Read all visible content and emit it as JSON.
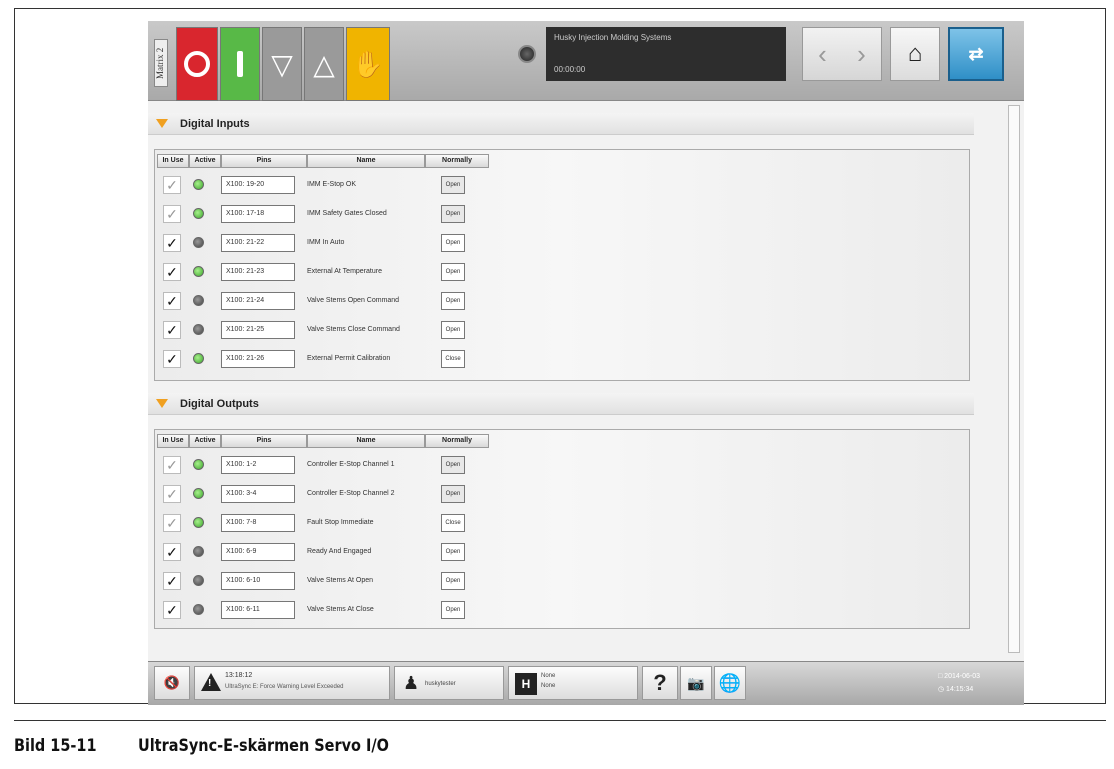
{
  "topbar": {
    "matrix_tab": "Matrix 2",
    "status_title": "Husky Injection Molding Systems",
    "status_time": "00:00:00"
  },
  "inputs": {
    "title": "Digital Inputs",
    "headers": [
      "In Use",
      "Active",
      "Pins",
      "Name",
      "Normally"
    ],
    "rows": [
      {
        "in_use": "✓",
        "active": "green",
        "pin": "X100: 19-20",
        "name": "IMM E-Stop OK",
        "normally": "Open"
      },
      {
        "in_use": "✓",
        "active": "green",
        "pin": "X100: 17-18",
        "name": "IMM Safety Gates Closed",
        "normally": "Open"
      },
      {
        "in_use": "✓",
        "active": "gray",
        "pin": "X100: 21-22",
        "name": "IMM In Auto",
        "normally": "Open"
      },
      {
        "in_use": "✓",
        "active": "green",
        "pin": "X100: 21-23",
        "name": "External At Temperature",
        "normally": "Open"
      },
      {
        "in_use": "✓",
        "active": "gray",
        "pin": "X100: 21-24",
        "name": "Valve Stems Open Command",
        "normally": "Open"
      },
      {
        "in_use": "✓",
        "active": "gray",
        "pin": "X100: 21-25",
        "name": "Valve Stems Close Command",
        "normally": "Open"
      },
      {
        "in_use": "✓",
        "active": "green",
        "pin": "X100: 21-26",
        "name": "External Permit Calibration",
        "normally": "Close"
      }
    ]
  },
  "outputs": {
    "title": "Digital Outputs",
    "headers": [
      "In Use",
      "Active",
      "Pins",
      "Name",
      "Normally"
    ],
    "rows": [
      {
        "in_use": "✓",
        "active": "green",
        "pin": "X100: 1-2",
        "name": "Controller E-Stop Channel 1",
        "normally": "Open"
      },
      {
        "in_use": "✓",
        "active": "green",
        "pin": "X100: 3-4",
        "name": "Controller E-Stop Channel 2",
        "normally": "Open"
      },
      {
        "in_use": "✓",
        "active": "green",
        "pin": "X100: 7-8",
        "name": "Fault Stop Immediate",
        "normally": "Close"
      },
      {
        "in_use": "✓",
        "active": "gray",
        "pin": "X100: 6-9",
        "name": "Ready And Engaged",
        "normally": "Open"
      },
      {
        "in_use": "✓",
        "active": "gray",
        "pin": "X100: 6-10",
        "name": "Valve Stems At Open",
        "normally": "Open"
      },
      {
        "in_use": "✓",
        "active": "gray",
        "pin": "X100: 6-11",
        "name": "Valve Stems At Close",
        "normally": "Open"
      }
    ]
  },
  "bottombar": {
    "alarm_time": "13:18:12",
    "alarm_text": "UltraSync E: Force Warning Level Exceeded",
    "user": "huskytester",
    "mold_1": "None",
    "mold_2": "None",
    "help": "?",
    "date": "□ 2014-06-03",
    "time": "◷ 14:15:34"
  },
  "caption": {
    "number": "Bild 15-11",
    "text": "UltraSync-E-skärmen Servo I/O"
  },
  "icons": {
    "stop": "stop-icon",
    "start": "start-icon",
    "down": "down-triangle-icon",
    "up": "up-triangle-icon",
    "manual": "manual-hand-icon",
    "home": "home-icon",
    "io": "io-screen-icon",
    "mute": "mute-icon",
    "warning": "warning-icon",
    "user": "user-icon",
    "mold": "mold-icon",
    "screenshot": "screenshot-icon",
    "globe": "globe-icon"
  },
  "colors": {
    "stop": "#d9262e",
    "start": "#58b947",
    "manual": "#f0b400",
    "accent_triangle": "#f0a020",
    "led_on": "#3aa52a",
    "led_off": "#444444",
    "io_button": "#2f8fc7"
  }
}
